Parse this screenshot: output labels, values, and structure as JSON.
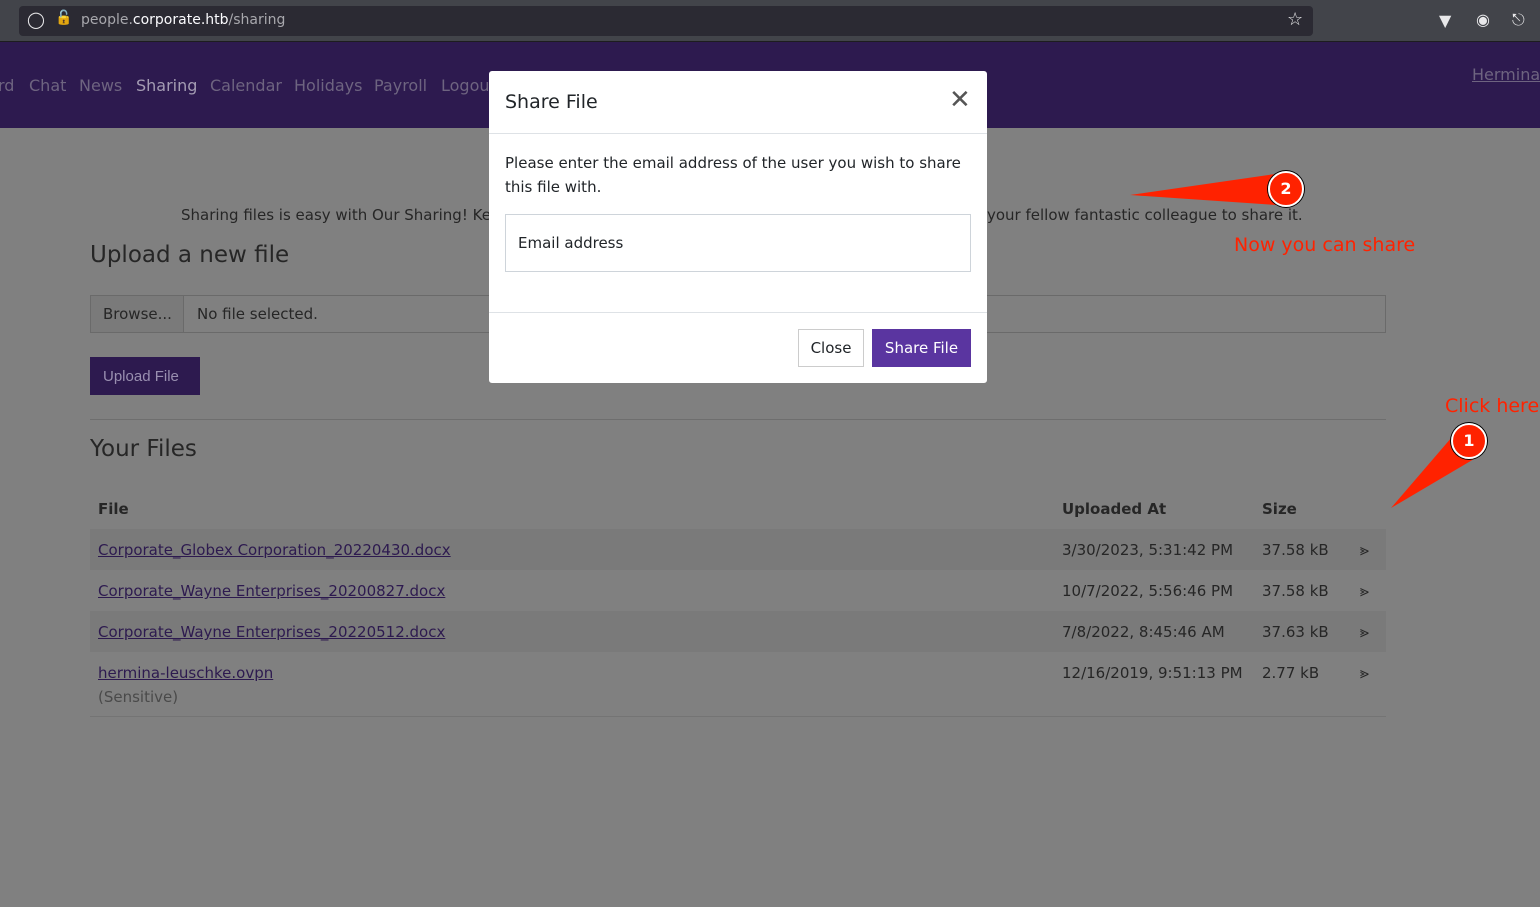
{
  "browser": {
    "url_prefix": "people.",
    "url_domain": "corporate.htb",
    "url_path": "/sharing"
  },
  "nav": {
    "items": [
      {
        "label": "rd"
      },
      {
        "label": "Chat"
      },
      {
        "label": "News"
      },
      {
        "label": "Sharing",
        "active": true
      },
      {
        "label": "Calendar"
      },
      {
        "label": "Holidays"
      },
      {
        "label": "Payroll"
      },
      {
        "label": "Logou"
      }
    ],
    "user": "Hermina"
  },
  "intro": {
    "left": "Sharing files is easy with Our Sharing! Ke",
    "right": "your fellow fantastic colleague to share it."
  },
  "upload": {
    "heading": "Upload a new file",
    "browse": "Browse...",
    "no_file": "No file selected.",
    "button": "Upload File"
  },
  "files": {
    "heading": "Your Files",
    "columns": [
      "File",
      "Uploaded At",
      "Size"
    ],
    "rows": [
      {
        "name": "Corporate_Globex Corporation_20220430.docx",
        "uploaded": "3/30/2023, 5:31:42 PM",
        "size": "37.58 kB"
      },
      {
        "name": "Corporate_Wayne Enterprises_20200827.docx",
        "uploaded": "10/7/2022, 5:56:46 PM",
        "size": "37.58 kB"
      },
      {
        "name": "Corporate_Wayne Enterprises_20220512.docx",
        "uploaded": "7/8/2022, 8:45:46 AM",
        "size": "37.63 kB"
      },
      {
        "name": "hermina-leuschke.ovpn",
        "note": "(Sensitive)",
        "uploaded": "12/16/2019, 9:51:13 PM",
        "size": "2.77 kB"
      }
    ]
  },
  "modal": {
    "title": "Share File",
    "body": "Please enter the email address of the user you wish to share this file with.",
    "email_placeholder": "Email address",
    "close": "Close",
    "share": "Share File"
  },
  "annotations": {
    "one_label": "Click here",
    "one_num": "1",
    "two_label": "Now you can share",
    "two_num": "2",
    "color": "#ff2200"
  }
}
